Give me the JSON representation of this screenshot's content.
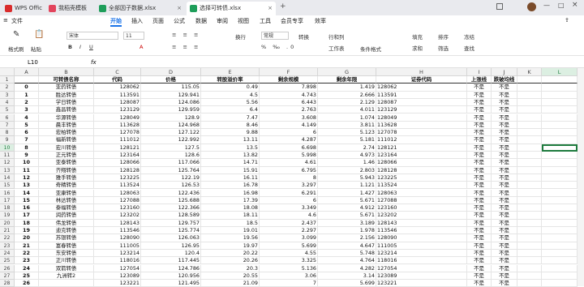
{
  "tabs": [
    {
      "label": "WPS Office",
      "color": "#d92b2b"
    },
    {
      "label": "我稻壳模板",
      "color": "#e2445c"
    },
    {
      "label": "全部因子数据.xlsx",
      "color": "#1e9e5a"
    },
    {
      "label": "选择可转债.xlsx",
      "color": "#1e9e5a"
    }
  ],
  "menu": [
    "文件",
    "开始",
    "插入",
    "页面",
    "公式",
    "数据",
    "审阅",
    "视图",
    "工具",
    "会员专享",
    "效率"
  ],
  "active_menu": "开始",
  "ribbon": {
    "format_painter": "格式刷",
    "paste": "粘贴",
    "font": "宋体",
    "size": "11",
    "wrap": "换行",
    "number_format": "常规",
    "convert": "转换",
    "row_col": "行和列",
    "worksheet": "工作表",
    "cond_format": "条件格式",
    "fill": "填充",
    "sort": "排序",
    "freeze": "冻结",
    "sum": "求和",
    "filter": "筛选",
    "find": "查找"
  },
  "formula_bar": {
    "cell_ref": "L10",
    "fx": "fx",
    "value": ""
  },
  "columns": [
    "A",
    "B",
    "C",
    "D",
    "E",
    "F",
    "G",
    "H",
    "I",
    "J",
    "K",
    "L"
  ],
  "header_row": [
    "",
    "可转债名称",
    "代码",
    "价格",
    "转股溢价率",
    "剩余规模",
    "剩余年限",
    "证券代码",
    "上涨线",
    "跌破均线"
  ],
  "rows": [
    [
      "0",
      "亚药转债",
      "128062",
      "115.05",
      "0.49",
      "7.898",
      "1.419",
      "128062",
      "不是",
      "不是"
    ],
    [
      "1",
      "胜达转债",
      "113591",
      "129.941",
      "4.5",
      "4.743",
      "2.666",
      "113591",
      "不是",
      "不是"
    ],
    [
      "2",
      "学日转债",
      "128087",
      "124.086",
      "5.56",
      "6.443",
      "2.129",
      "128087",
      "不是",
      "不是"
    ],
    [
      "3",
      "鑫昌转债",
      "123129",
      "129.959",
      "6.4",
      "2.763",
      "4.011",
      "123129",
      "不是",
      "不是"
    ],
    [
      "4",
      "华源转债",
      "128049",
      "128.9",
      "7.47",
      "3.608",
      "1.074",
      "128049",
      "不是",
      "不是"
    ],
    [
      "5",
      "晨丰转债",
      "113628",
      "124.968",
      "8.46",
      "4.149",
      "3.811",
      "113628",
      "不是",
      "不是"
    ],
    [
      "6",
      "宏柏转债",
      "127078",
      "127.122",
      "9.88",
      "6",
      "5.123",
      "127078",
      "不是",
      "不是"
    ],
    [
      "7",
      "福新转债",
      "111012",
      "122.992",
      "13.11",
      "4.287",
      "5.181",
      "111012",
      "不是",
      "不是"
    ],
    [
      "8",
      "宏川转债",
      "128121",
      "127.5",
      "13.5",
      "6.698",
      "2.74",
      "128121",
      "不是",
      "不是"
    ],
    [
      "9",
      "正元转债",
      "123164",
      "128.6",
      "13.82",
      "5.998",
      "4.973",
      "123164",
      "不是",
      "不是"
    ],
    [
      "10",
      "亚泰转债",
      "128066",
      "117.066",
      "14.71",
      "4.61",
      "1.46",
      "128066",
      "不是",
      "不是"
    ],
    [
      "11",
      "齐翔转债",
      "128128",
      "125.764",
      "15.91",
      "6.795",
      "2.803",
      "128128",
      "不是",
      "不是"
    ],
    [
      "12",
      "雅手转债",
      "123225",
      "122.19",
      "16.11",
      "8",
      "5.943",
      "123225",
      "不是",
      "不是"
    ],
    [
      "13",
      "奇精转债",
      "113524",
      "126.53",
      "16.78",
      "3.297",
      "1.121",
      "113524",
      "不是",
      "不是"
    ],
    [
      "14",
      "亚康转债",
      "128063",
      "122.436",
      "16.98",
      "6.291",
      "1.427",
      "128063",
      "不是",
      "不是"
    ],
    [
      "15",
      "林达转债",
      "127088",
      "125.688",
      "17.39",
      "6",
      "5.671",
      "127088",
      "不是",
      "不是"
    ],
    [
      "16",
      "泰福转债",
      "123160",
      "122.366",
      "18.08",
      "3.349",
      "4.912",
      "123160",
      "不是",
      "不是"
    ],
    [
      "17",
      "润药转债",
      "123202",
      "128.589",
      "18.11",
      "4.6",
      "5.671",
      "123202",
      "不是",
      "不是"
    ],
    [
      "18",
      "伟龙转债",
      "128143",
      "129.757",
      "18.5",
      "2.437",
      "3.189",
      "128143",
      "不是",
      "不是"
    ],
    [
      "19",
      "迪克转债",
      "113546",
      "125.774",
      "19.01",
      "2.297",
      "1.978",
      "113546",
      "不是",
      "不是"
    ],
    [
      "20",
      "苏银转债",
      "128090",
      "126.063",
      "19.56",
      "3.099",
      "2.156",
      "128090",
      "不是",
      "不是"
    ],
    [
      "21",
      "富春转债",
      "111005",
      "126.95",
      "19.97",
      "5.699",
      "4.647",
      "111005",
      "不是",
      "不是"
    ],
    [
      "22",
      "东安转债",
      "123214",
      "120.4",
      "20.22",
      "4.55",
      "5.748",
      "123214",
      "不是",
      "不是"
    ],
    [
      "23",
      "正川转债",
      "118016",
      "117.445",
      "20.26",
      "3.325",
      "4.764",
      "118016",
      "不是",
      "不是"
    ],
    [
      "24",
      "双箭转债",
      "127054",
      "124.786",
      "20.3",
      "5.136",
      "4.282",
      "127054",
      "不是",
      "不是"
    ],
    [
      "25",
      "九洲转2",
      "123089",
      "120.956",
      "20.55",
      "3.06",
      "3.14",
      "123089",
      "不是",
      "不是"
    ],
    [
      "26",
      "",
      "123221",
      "121.495",
      "21.09",
      "7",
      "5.699",
      "123221",
      "不是",
      "不是"
    ]
  ]
}
